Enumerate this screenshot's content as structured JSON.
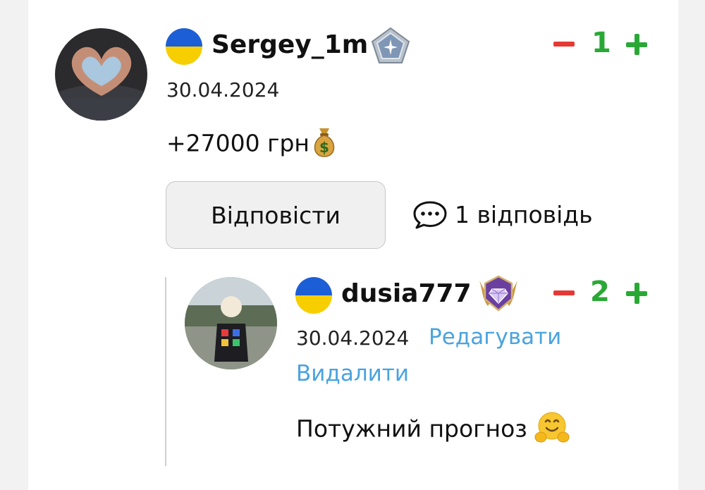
{
  "comment": {
    "avatar": "heart-hands-avatar",
    "flag": "ukraine-flag-icon",
    "username": "Sergey_1m",
    "badge": "silver-pentagon-badge-icon",
    "votes": {
      "count": "1"
    },
    "date": "30.04.2024",
    "text": "+27000 грн",
    "text_emoji": "money-bag-emoji",
    "reply_button": "Відповісти",
    "replies_label": "1 відповідь"
  },
  "reply": {
    "avatar": "child-photo-avatar",
    "flag": "ukraine-flag-icon",
    "username": "dusia777",
    "badge": "purple-diamond-winged-badge-icon",
    "votes": {
      "count": "2"
    },
    "date": "30.04.2024",
    "edit_link": "Редагувати",
    "delete_link": "Видалити",
    "text": "Потужний прогноз",
    "text_emoji": "hugging-face-emoji"
  },
  "colors": {
    "minus": "#e53935",
    "plus": "#2aa836",
    "link": "#4aa3df",
    "flag_blue": "#1c5ed6",
    "flag_yellow": "#f7cf00"
  }
}
